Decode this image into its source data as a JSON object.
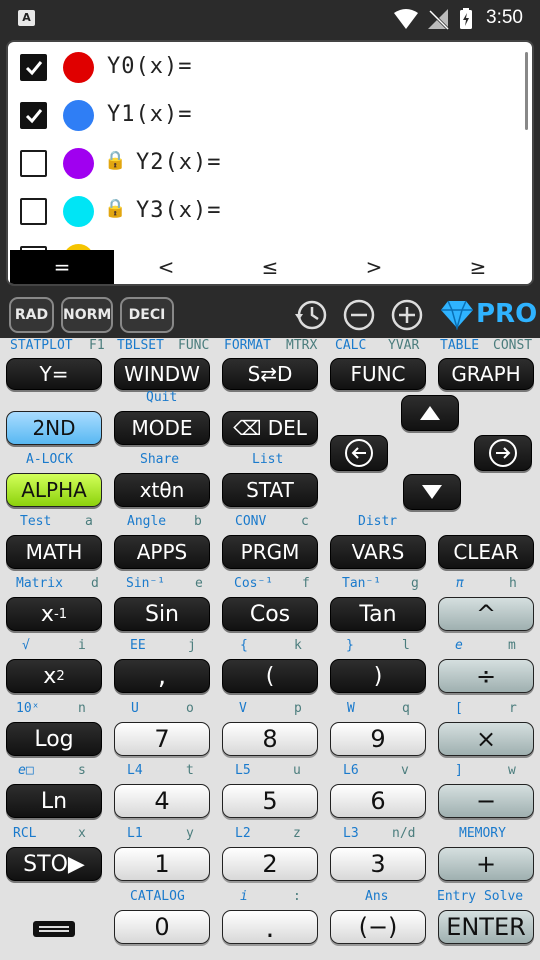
{
  "status_bar": {
    "time": "3:50",
    "app_icon_letter": "A"
  },
  "equations": [
    {
      "label": "Y0(x)=",
      "checked": true,
      "color": "#e00000",
      "locked": false
    },
    {
      "label": "Y1(x)=",
      "checked": true,
      "color": "#2f7ef5",
      "locked": false
    },
    {
      "label": "Y2(x)=",
      "checked": false,
      "color": "#a000f0",
      "locked": true
    },
    {
      "label": "Y3(x)=",
      "checked": false,
      "color": "#00e5f5",
      "locked": true
    }
  ],
  "relations": [
    "=",
    "<",
    "≤",
    ">",
    "≥"
  ],
  "mode_bar": {
    "angle": "RAD",
    "format": "NORM",
    "number": "DECI",
    "pro_label": "PRO"
  },
  "top_labels": {
    "statplot": "STATPLOT",
    "f1": "F1",
    "tblset": "TBLSET",
    "func": "FUNC",
    "format": "FORMAT",
    "mtrx": "MTRX",
    "calc": "CALC",
    "yvar": "YVAR",
    "table": "TABLE",
    "const": "CONST"
  },
  "keys": {
    "y_eq": "Y=",
    "window": "WINDW",
    "s_d": "S⇄D",
    "func": "FUNC",
    "graph": "GRAPH",
    "second": "2ND",
    "mode": "MODE",
    "del": "⌫ DEL",
    "alpha": "ALPHA",
    "xttn": "xtθn",
    "stat": "STAT",
    "math": "MATH",
    "apps": "APPS",
    "prgm": "PRGM",
    "vars": "VARS",
    "clear": "CLEAR",
    "sin": "Sin",
    "cos": "Cos",
    "tan": "Tan",
    "caret": "^",
    "comma": ",",
    "lparen": "(",
    "rparen": ")",
    "divide": "÷",
    "log": "Log",
    "seven": "7",
    "eight": "8",
    "nine": "9",
    "times": "×",
    "ln": "Ln",
    "four": "4",
    "five": "5",
    "six": "6",
    "minus": "−",
    "sto": "STO▶",
    "one": "1",
    "two": "2",
    "three": "3",
    "plus": "+",
    "zero": "0",
    "dot": ".",
    "neg": "(−)",
    "enter": "ENTER"
  },
  "secondary_labels": {
    "quit": "Quit",
    "alock": "A-LOCK",
    "share": "Share",
    "list": "List",
    "test": "Test",
    "a": "a",
    "angle": "Angle",
    "b": "b",
    "conv": "CONV",
    "c": "c",
    "distr": "Distr",
    "matrix": "Matrix",
    "d": "d",
    "sin_inv": "Sin⁻¹",
    "e": "e",
    "cos_inv": "Cos⁻¹",
    "f": "f",
    "tan_inv": "Tan⁻¹",
    "g": "g",
    "pi": "π",
    "h": "h",
    "sqrt": "√",
    "i": "i",
    "ee": "EE",
    "j": "j",
    "lbrace": "{",
    "k": "k",
    "rbrace": "}",
    "l": "l",
    "e_const": "e",
    "m": "m",
    "ten_x": "10ˣ",
    "n": "n",
    "u": "U",
    "o": "o",
    "v": "V",
    "p": "p",
    "w": "W",
    "q": "q",
    "lbracket": "[",
    "r": "r",
    "e_pow": "e□",
    "s": "s",
    "l4": "L4",
    "t": "t",
    "l5": "L5",
    "u_low": "u",
    "l6": "L6",
    "v_low": "v",
    "rbracket": "]",
    "w_low": "w",
    "rcl": "RCL",
    "x": "x",
    "l1": "L1",
    "y": "y",
    "l2": "L2",
    "z": "z",
    "l3": "L3",
    "nd": "n/d",
    "memory": "MEMORY",
    "catalog": "CATALOG",
    "i_const": "i",
    "colon": ":",
    "ans": "Ans",
    "entry_solve": "Entry Solve"
  },
  "colors": {
    "accent_blue": "#1a7acc",
    "alpha_green": "#8cd20c",
    "second_blue": "#58b8f2",
    "pro_blue": "#2fb3ff"
  }
}
